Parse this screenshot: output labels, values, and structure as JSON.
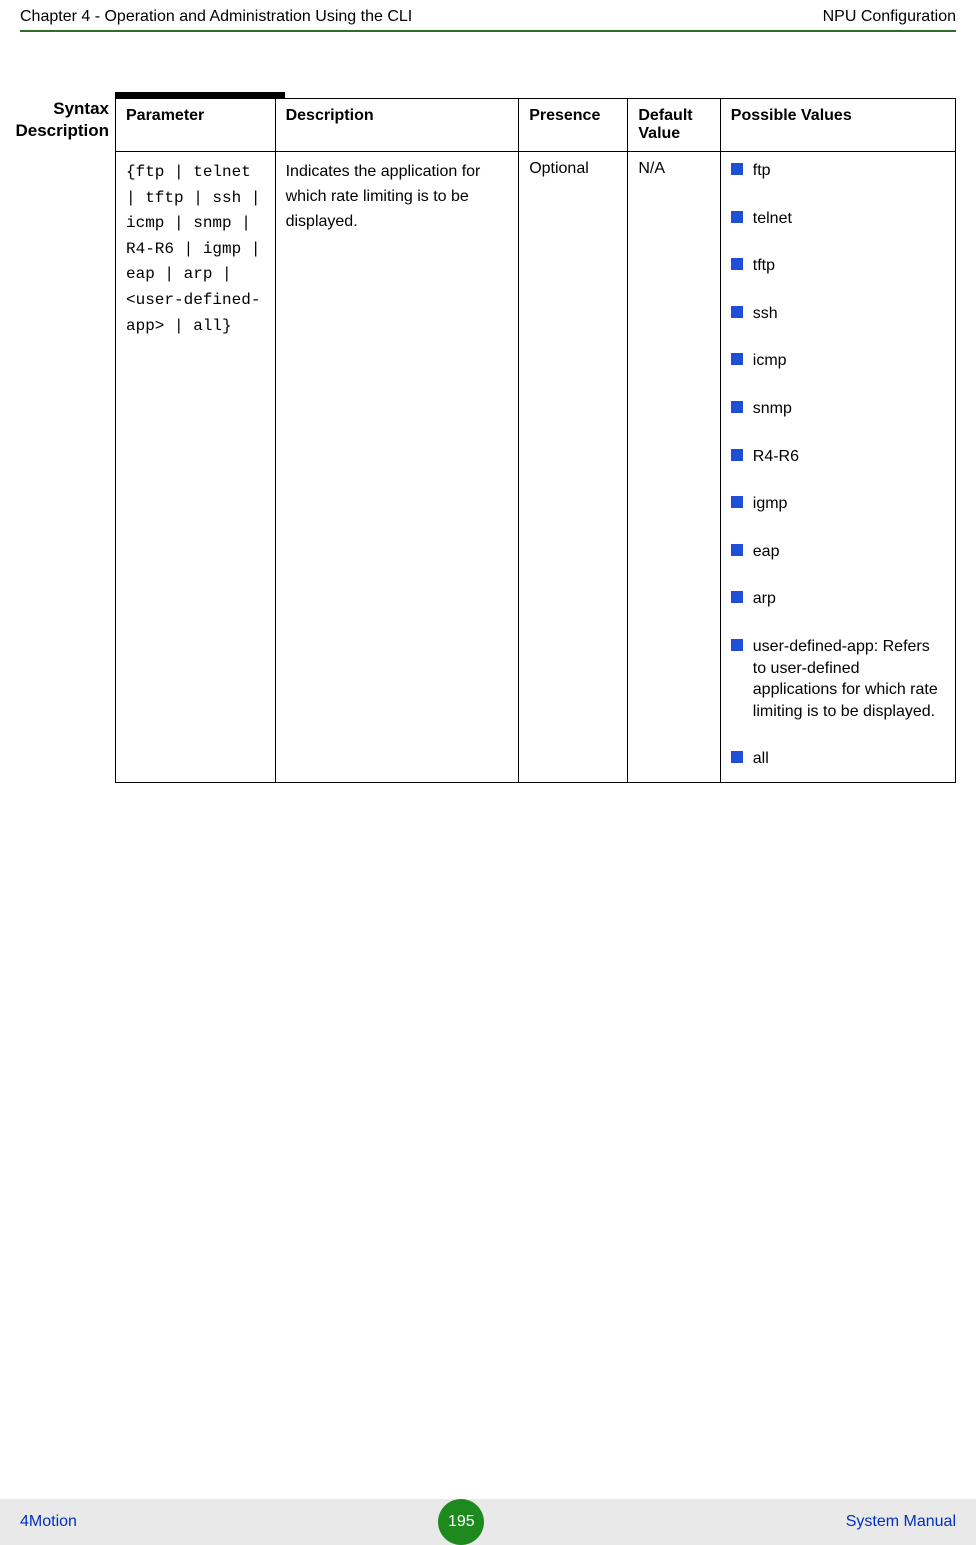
{
  "header": {
    "left": "Chapter 4 - Operation and Administration Using the CLI",
    "right": "NPU Configuration"
  },
  "sideLabel": {
    "line1": "Syntax",
    "line2": "Description"
  },
  "columns": {
    "parameter": "Parameter",
    "description": "Description",
    "presence": "Presence",
    "defaultValue": "Default Value",
    "possibleValues": "Possible Values"
  },
  "row": {
    "parameter": "{ftp | telnet | tftp | ssh | icmp | snmp | R4-R6 | igmp | eap | arp | <user-defined-app> | all}",
    "description": "Indicates the application for which rate limiting is to be displayed.",
    "presence": "Optional",
    "defaultValue": "N/A",
    "values": {
      "v1": "ftp",
      "v2": "telnet",
      "v3": "tftp",
      "v4": "ssh",
      "v5": "icmp",
      "v6": "snmp",
      "v7": "R4-R6",
      "v8": "igmp",
      "v9": "eap",
      "v10": "arp",
      "v11": "user-defined-app: Refers to user-defined applications for which rate limiting is to be displayed.",
      "v12": "all"
    }
  },
  "footer": {
    "left": "4Motion",
    "page": "195",
    "right": "System Manual"
  }
}
